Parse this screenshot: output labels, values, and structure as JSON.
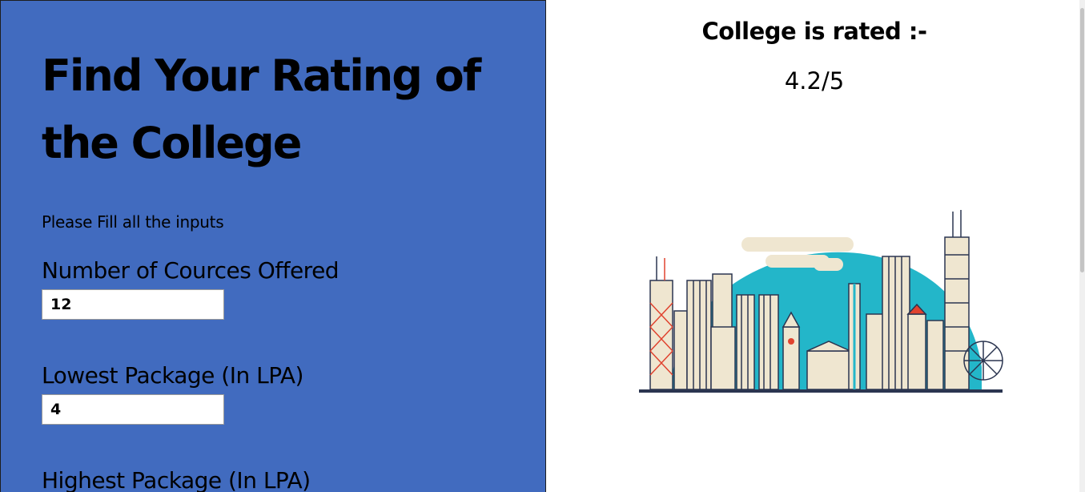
{
  "form": {
    "title": "Find Your Rating of the College",
    "instructions": "Please Fill all the inputs",
    "fields": [
      {
        "label": "Number of Cources Offered",
        "value": "12"
      },
      {
        "label": "Lowest Package (In LPA)",
        "value": "4"
      },
      {
        "label": "Highest Package (In LPA)",
        "value": ""
      }
    ]
  },
  "result": {
    "heading": "College is rated :-",
    "value": "4.2/5"
  },
  "colors": {
    "panel_bg": "#416bbf",
    "sky": "#23b6c9",
    "building": "#efe6d0",
    "outline": "#2b3550",
    "accent_red": "#e0432f"
  }
}
